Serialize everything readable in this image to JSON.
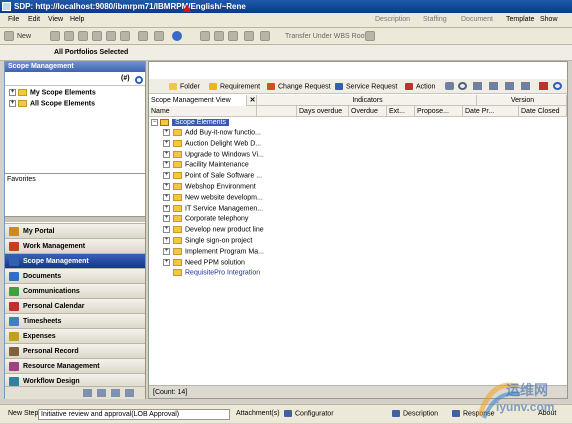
{
  "window": {
    "title": "SDP: http://localhost:9080/ibmrpm71/IBMRPM/English/~Rene"
  },
  "menu": [
    "File",
    "Edit",
    "View",
    "Help"
  ],
  "top_tools": [
    "Description",
    "Staffing",
    "Document",
    "Template",
    "Show"
  ],
  "toolbar": {
    "new_label": "New",
    "transfer_label": "Transfer Under WBS Root"
  },
  "portfolio_label": "All Portfolios Selected",
  "left_panel": {
    "header": "Scope Management",
    "hash_label": "(#)",
    "tree": [
      "My Scope Elements",
      "All Scope Elements"
    ],
    "favorites_label": "Favorites"
  },
  "nav": [
    {
      "label": "My Portal",
      "color": "#d08820"
    },
    {
      "label": "Work Management",
      "color": "#c04020"
    },
    {
      "label": "Scope Management",
      "color": "#3060b0"
    },
    {
      "label": "Documents",
      "color": "#3070c0"
    },
    {
      "label": "Communications",
      "color": "#40a040"
    },
    {
      "label": "Personal Calendar",
      "color": "#c03030"
    },
    {
      "label": "Timesheets",
      "color": "#4080c0"
    },
    {
      "label": "Expenses",
      "color": "#c0a020"
    },
    {
      "label": "Personal Record",
      "color": "#806040"
    },
    {
      "label": "Resource Management",
      "color": "#a04080"
    },
    {
      "label": "Workflow Design",
      "color": "#3080a0"
    }
  ],
  "ribbon": [
    "Folder",
    "Requirement",
    "Change Request",
    "Service Request",
    "Action"
  ],
  "view": {
    "selector": "Scope Management View",
    "indicators_label": "Indicators",
    "version_label": "Version",
    "columns": [
      "Name",
      "Days overdue",
      "Overdue",
      "Ext...",
      "Propose...",
      "Date Pr...",
      "Date Closed"
    ]
  },
  "tree_root": "Scope Elements",
  "rows": [
    "Add Buy-it-now functio...",
    "Auction Delight Web D...",
    "Upgrade to Windows Vi...",
    "Facility Maintenance",
    "Point of Sale Software ...",
    "Webshop Environment",
    "New website developm...",
    "IT Service Managemen...",
    "Corporate telephony",
    "Develop new product line",
    "Single sign-on project",
    "Implement Program Ma...",
    "Need PPM solution",
    "RequisitePro Integration"
  ],
  "count_label": "[Count: 14]",
  "bottom": {
    "next_step_label": "New Step",
    "workflow_value": "Initiative review and approval(LOB Approval)",
    "attachments_label": "Attachment(s)",
    "configurator_label": "Configurator",
    "description_label": "Description",
    "response_label": "Response",
    "about_label": "About"
  },
  "watermark": {
    "line1": "运维网",
    "line2": "iyunv.com"
  }
}
